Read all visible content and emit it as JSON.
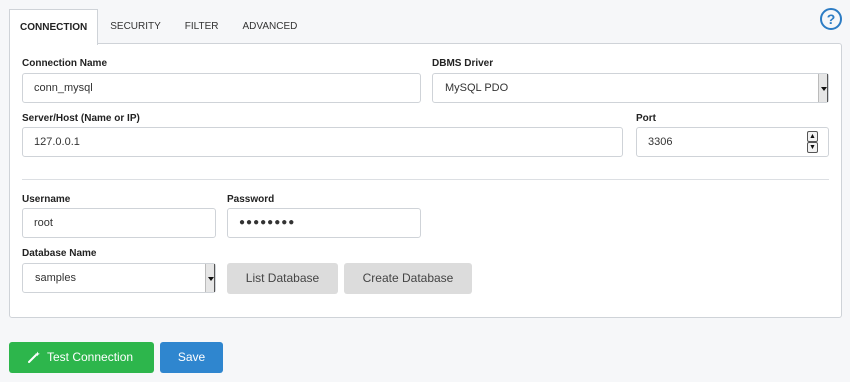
{
  "tabs": [
    {
      "label": "CONNECTION",
      "active": true
    },
    {
      "label": "SECURITY",
      "active": false
    },
    {
      "label": "FILTER",
      "active": false
    },
    {
      "label": "ADVANCED",
      "active": false
    }
  ],
  "help": {
    "label": "?"
  },
  "form": {
    "connection_name": {
      "label": "Connection Name",
      "value": "conn_mysql"
    },
    "dbms_driver": {
      "label": "DBMS Driver",
      "value": "MySQL PDO"
    },
    "server_host": {
      "label": "Server/Host (Name or IP)",
      "value": "127.0.0.1"
    },
    "port": {
      "label": "Port",
      "value": "3306"
    },
    "username": {
      "label": "Username",
      "value": "root"
    },
    "password": {
      "label": "Password",
      "value": "●●●●●●●●"
    },
    "database_name": {
      "label": "Database Name",
      "value": "samples"
    }
  },
  "buttons": {
    "list_database": "List Database",
    "create_database": "Create Database",
    "test_connection": "Test Connection",
    "save": "Save"
  },
  "colors": {
    "test_button": "#2db64c",
    "save_button": "#2f86cf",
    "help_icon": "#2c7cc4"
  }
}
